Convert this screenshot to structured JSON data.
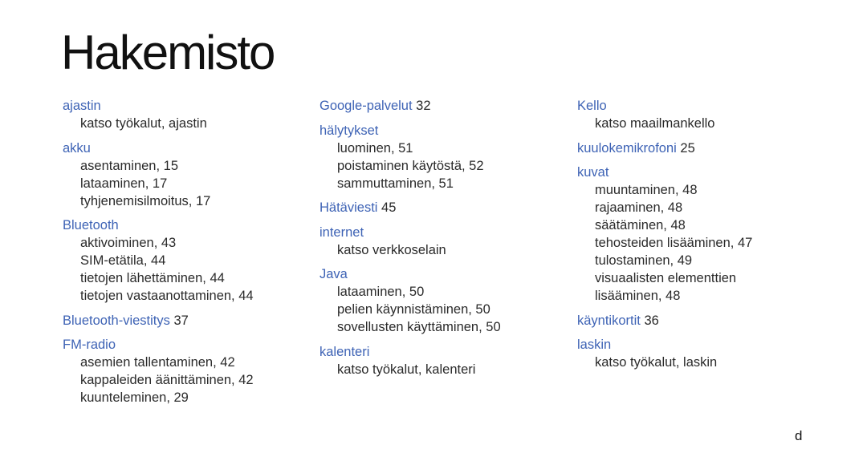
{
  "title": "Hakemisto",
  "page_marker": "d",
  "accent_color": "#3e63b5",
  "columns": [
    [
      {
        "term": "ajastin",
        "page": "",
        "subs": [
          "katso työkalut, ajastin"
        ]
      },
      {
        "term": "akku",
        "page": "",
        "subs": [
          "asentaminen, 15",
          "lataaminen, 17",
          "tyhjenemisilmoitus, 17"
        ]
      },
      {
        "term": "Bluetooth",
        "page": "",
        "subs": [
          "aktivoiminen, 43",
          "SIM-etätila, 44",
          "tietojen lähettäminen, 44",
          "tietojen vastaanottaminen, 44"
        ]
      },
      {
        "term": "Bluetooth-viestitys",
        "page": "37",
        "subs": []
      },
      {
        "term": "FM-radio",
        "page": "",
        "subs": [
          "asemien tallentaminen, 42",
          "kappaleiden äänittäminen, 42",
          "kuunteleminen, 29"
        ]
      }
    ],
    [
      {
        "term": "Google-palvelut",
        "page": "32",
        "subs": []
      },
      {
        "term": "hälytykset",
        "page": "",
        "subs": [
          "luominen, 51",
          "poistaminen käytöstä, 52",
          "sammuttaminen, 51"
        ]
      },
      {
        "term": "Hätäviesti",
        "page": "45",
        "subs": []
      },
      {
        "term": "internet",
        "page": "",
        "subs": [
          "katso verkkoselain"
        ]
      },
      {
        "term": "Java",
        "page": "",
        "subs": [
          "lataaminen, 50",
          "pelien käynnistäminen, 50",
          "sovellusten käyttäminen, 50"
        ]
      },
      {
        "term": "kalenteri",
        "page": "",
        "subs": [
          "katso työkalut, kalenteri"
        ]
      }
    ],
    [
      {
        "term": "Kello",
        "page": "",
        "subs": [
          "katso maailmankello"
        ]
      },
      {
        "term": "kuulokemikrofoni",
        "page": "25",
        "subs": []
      },
      {
        "term": "kuvat",
        "page": "",
        "subs": [
          "muuntaminen, 48",
          "rajaaminen, 48",
          "säätäminen, 48",
          "tehosteiden lisääminen, 47",
          "tulostaminen, 49",
          "visuaalisten elementtien",
          "lisääminen, 48"
        ]
      },
      {
        "term": "käyntikortit",
        "page": "36",
        "subs": []
      },
      {
        "term": "laskin",
        "page": "",
        "subs": [
          "katso työkalut, laskin"
        ]
      }
    ]
  ]
}
